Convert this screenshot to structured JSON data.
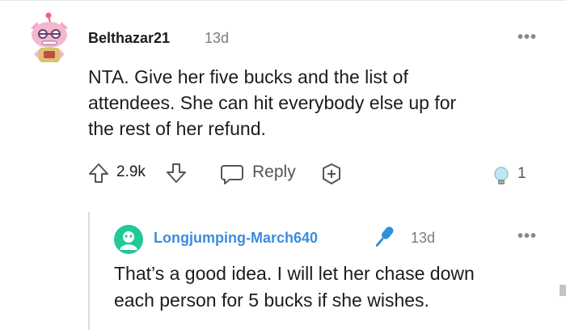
{
  "main_comment": {
    "username": "Belthazar21",
    "timestamp": "13d",
    "more_label": "•••",
    "body_lines": [
      "NTA. Give her five bucks and the list of",
      "attendees. She can hit everybody else up for",
      "the rest of her refund."
    ],
    "vote_count": "2.9k",
    "reply_label": "Reply",
    "award_count": "1",
    "icons": [
      "upvote-icon",
      "downvote-icon",
      "reply-icon",
      "award-icon",
      "lightbulb-icon",
      "more-icon"
    ]
  },
  "reply_comment": {
    "username": "Longjumping-March640",
    "timestamp": "13d",
    "more_label": "•••",
    "body_lines": [
      "That’s a good idea. I will let her chase down",
      "each person for 5 bucks if she wishes."
    ],
    "icons": [
      "avatar-icon",
      "microphone-icon",
      "more-icon"
    ]
  },
  "colors": {
    "username_reply": "#3a8dde",
    "timestamp": "#7c7c7c",
    "thread_line": "#dadcde",
    "avatar_reply_bg": "#22c997"
  }
}
